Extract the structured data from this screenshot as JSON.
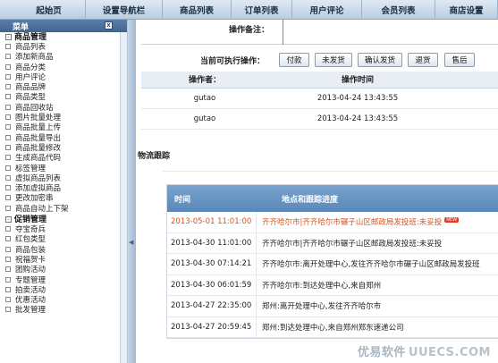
{
  "topnav": [
    "起始页",
    "设置导航栏",
    "商品列表",
    "订单列表",
    "用户评论",
    "会员列表",
    "商店设置"
  ],
  "sidebar": {
    "title": "菜单",
    "close": "x",
    "groups": [
      {
        "label": "商品管理",
        "toggle": "-",
        "items": [
          "商品列表",
          "添加新商品",
          "商品分类",
          "用户评论",
          "商品品牌",
          "商品类型",
          "商品回收站",
          "图片批量处理",
          "商品批量上传",
          "商品批量导出",
          "商品批量修改",
          "生成商品代码",
          "标签管理",
          "虚拟商品列表",
          "添加虚拟商品",
          "更改加密串",
          "商品自动上下架"
        ]
      },
      {
        "label": "促销管理",
        "toggle": "-",
        "items": [
          "夺宝奇兵",
          "红包类型",
          "商品包装",
          "祝福贺卡",
          "团购活动",
          "专题管理",
          "拍卖活动",
          "优惠活动",
          "批发管理"
        ]
      }
    ]
  },
  "order": {
    "remark_label": "操作备注：",
    "actions_label": "当前可执行操作：",
    "buttons": [
      "付款",
      "未发货",
      "确认发货",
      "退货",
      "售后"
    ],
    "log_headers": [
      "操作者：",
      "操作时间"
    ],
    "log_rows": [
      {
        "operator": "gutao",
        "time": "2013-04-24 13:43:55"
      },
      {
        "operator": "gutao",
        "time": "2013-04-24 13:43:55"
      }
    ]
  },
  "tracking": {
    "title": "物流跟踪",
    "headers": [
      "时间",
      "地点和跟踪进度"
    ],
    "badge": "NEW",
    "rows": [
      {
        "time": "2013-05-01 11:01:00",
        "detail": "齐齐哈尔市|齐齐哈尔市碾子山区邮政局发投班:未妥投"
      },
      {
        "time": "2013-04-30 11:01:00",
        "detail": "齐齐哈尔市|齐齐哈尔市碾子山区邮政局发投班:未妥投"
      },
      {
        "time": "2013-04-30 07:14:21",
        "detail": "齐齐哈尔市:离开处理中心,发往齐齐哈尔市碾子山区邮政局发投班"
      },
      {
        "time": "2013-04-30 06:01:59",
        "detail": "齐齐哈尔市:到达处理中心,来自郑州"
      },
      {
        "time": "2013-04-27 22:35:00",
        "detail": "郑州:离开处理中心,发往齐齐哈尔市"
      },
      {
        "time": "2013-04-27 20:59:45",
        "detail": "郑州:到达处理中心,来自郑州郑东速递公司"
      }
    ]
  },
  "watermark": {
    "logo": "优易软件",
    "site": "UUECS.COM"
  }
}
